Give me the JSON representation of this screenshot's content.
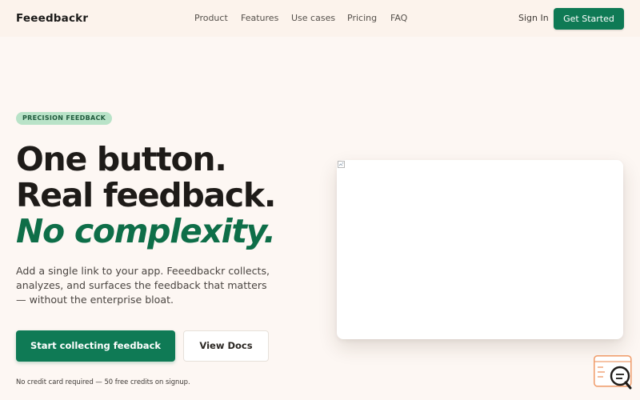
{
  "header": {
    "brand": "Feeedbackr",
    "nav": [
      "Product",
      "Features",
      "Use cases",
      "Pricing",
      "FAQ"
    ],
    "sign_in": "Sign In",
    "get_started": "Get Started"
  },
  "hero": {
    "badge": "PRECISION FEEDBACK",
    "headline_line1": "One button.",
    "headline_line2": "Real feedback.",
    "headline_line3": "No complexity.",
    "description": "Add a single link to your app. Feeedbackr collects, analyzes, and surfaces the feedback that matters — without the enterprise bloat.",
    "primary_cta": "Start collecting feedback",
    "secondary_cta": "View Docs",
    "note": "No credit card required — 50 free credits on signup."
  },
  "preview": {
    "image_icon": "broken-image-icon"
  },
  "widget": {
    "icon": "feedback-search-icon"
  },
  "colors": {
    "accent": "#0f7a55",
    "badge_bg": "#b9e3c8",
    "page_bg": "#fdf7f3",
    "widget_accent": "#f0a070"
  }
}
